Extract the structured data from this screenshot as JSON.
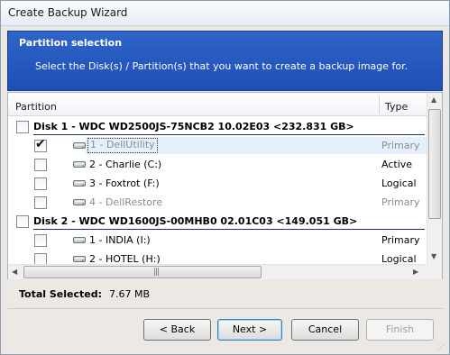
{
  "window": {
    "title": "Create Backup Wizard"
  },
  "header": {
    "title": "Partition selection",
    "description": "Select the Disk(s) / Partition(s)  that you want to create a backup image for."
  },
  "list": {
    "columns": {
      "partition": "Partition",
      "type": "Type"
    },
    "disks": [
      {
        "label": "Disk 1 - WDC WD2500JS-75NCB2 10.02E03  <232.831 GB>",
        "checked": false,
        "partitions": [
          {
            "label": "1 - DellUtility",
            "type": "Primary",
            "checked": true,
            "dim": true,
            "selected": true
          },
          {
            "label": "2 - Charlie (C:)",
            "type": "Active",
            "checked": false,
            "dim": false,
            "selected": false
          },
          {
            "label": "3 - Foxtrot (F:)",
            "type": "Logical",
            "checked": false,
            "dim": false,
            "selected": false
          },
          {
            "label": "4 - DellRestore",
            "type": "Primary",
            "checked": false,
            "dim": true,
            "selected": false
          }
        ]
      },
      {
        "label": "Disk 2 - WDC WD1600JS-00MHB0 02.01C03  <149.051 GB>",
        "checked": false,
        "partitions": [
          {
            "label": "1 - INDIA (I:)",
            "type": "Primary",
            "checked": false,
            "dim": false,
            "selected": false
          },
          {
            "label": "2 - HOTEL (H:)",
            "type": "Logical",
            "checked": false,
            "dim": false,
            "selected": false
          }
        ]
      }
    ]
  },
  "summary": {
    "label": "Total Selected:",
    "value": "7.67 MB"
  },
  "buttons": {
    "back": "< Back",
    "next": "Next >",
    "cancel": "Cancel",
    "finish": "Finish"
  },
  "icons": {
    "checkmark": "check-icon",
    "drive": "hard-drive-icon"
  }
}
